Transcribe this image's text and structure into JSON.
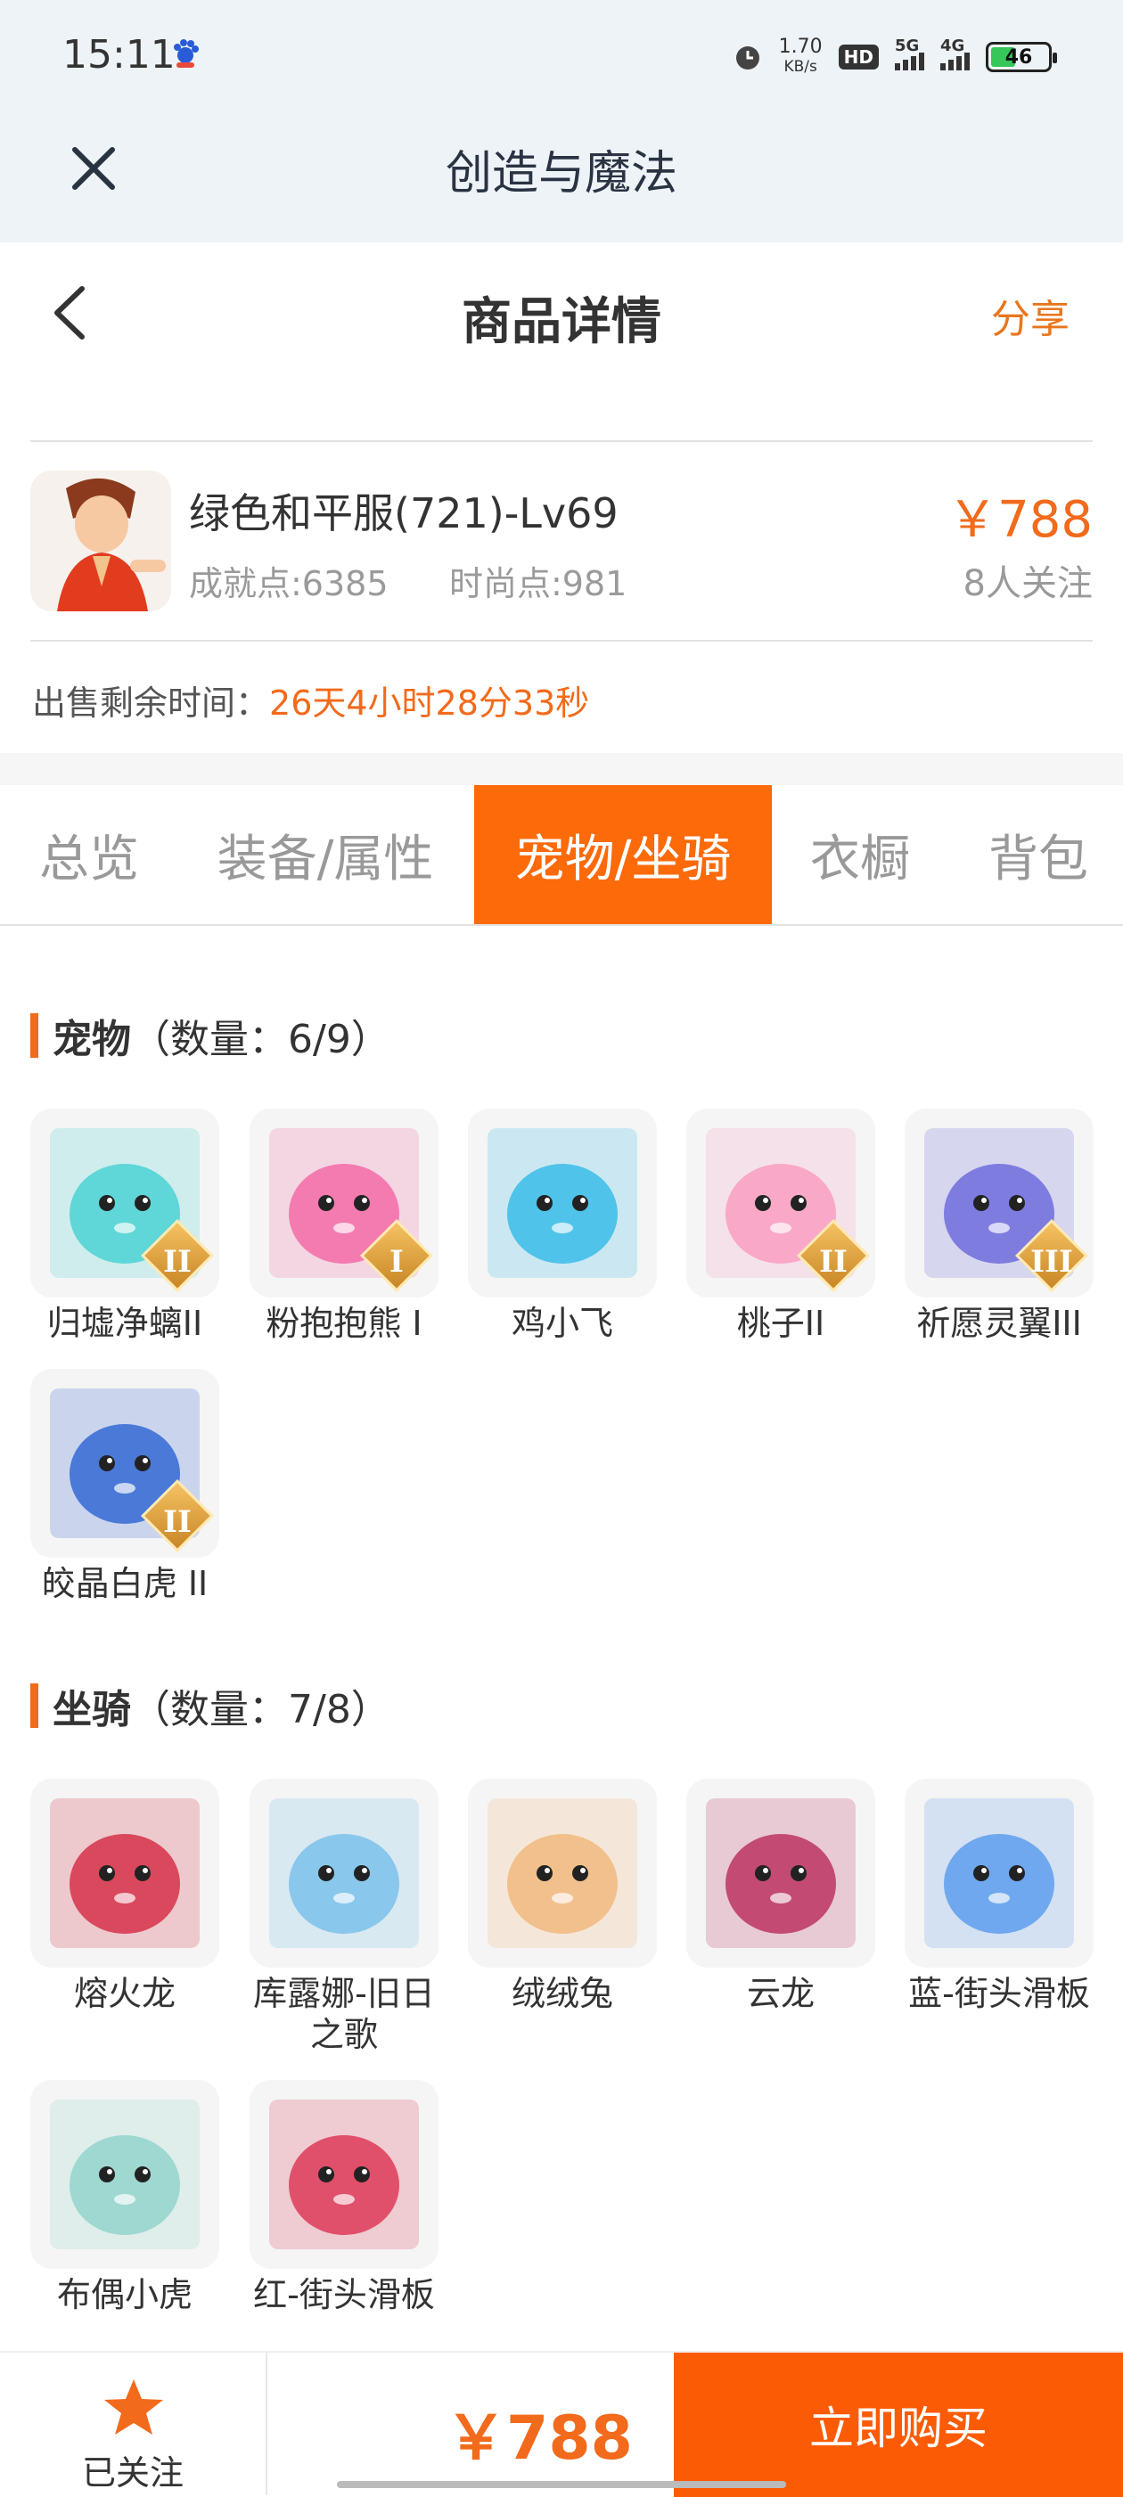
{
  "status_bar": {
    "time": "15:11",
    "net_speed_value": "1.70",
    "net_speed_unit": "KB/s",
    "hd": "HD",
    "sig1": "5G",
    "sig2": "4G",
    "battery": "46"
  },
  "app_bar": {
    "title": "创造与魔法",
    "close_icon": "close-icon"
  },
  "header": {
    "title": "商品详情",
    "share": "分享",
    "back_icon": "chevron-left-icon"
  },
  "product": {
    "name": "绿色和平服(721)-Lv69",
    "achievement": "成就点:6385",
    "fashion": "时尚点:981",
    "price": "￥788",
    "followers": "8人关注"
  },
  "remaining": {
    "label": "出售剩余时间：",
    "value": "26天4小时28分33秒"
  },
  "tabs": [
    {
      "label": "总览"
    },
    {
      "label": "装备/属性"
    },
    {
      "label": "宠物/坐骑",
      "active": true
    },
    {
      "label": "衣橱"
    },
    {
      "label": "背包"
    }
  ],
  "pets": {
    "title": "宠物",
    "count": "（数量：6/9）",
    "items": [
      {
        "label": "归墟净螭II",
        "grade": "II",
        "color": "#5fd6d8"
      },
      {
        "label": "粉抱抱熊 I",
        "grade": "I",
        "color": "#f47bb0"
      },
      {
        "label": "鸡小飞",
        "grade": "",
        "color": "#4fc3ea"
      },
      {
        "label": "桃子II",
        "grade": "II",
        "color": "#f9a8c7"
      },
      {
        "label": "祈愿灵翼III",
        "grade": "III",
        "color": "#7f7ce0"
      },
      {
        "label": "皎晶白虎 II",
        "grade": "II",
        "color": "#4a79d8"
      }
    ]
  },
  "mounts": {
    "title": "坐骑",
    "count": "（数量：7/8）",
    "items": [
      {
        "label": "熔火龙",
        "color": "#d9485c"
      },
      {
        "label": "库露娜-旧日之歌",
        "color": "#89c7ec"
      },
      {
        "label": "绒绒兔",
        "color": "#f2c08c"
      },
      {
        "label": "云龙",
        "color": "#c24a73"
      },
      {
        "label": "蓝-街头滑板",
        "color": "#6fa8ee"
      },
      {
        "label": "布偶小虎",
        "color": "#9ed8d1"
      },
      {
        "label": "红-街头滑板",
        "color": "#e0506a"
      }
    ]
  },
  "bottom": {
    "follow_label": "已关注",
    "price": "￥788",
    "buy": "立即购买"
  }
}
